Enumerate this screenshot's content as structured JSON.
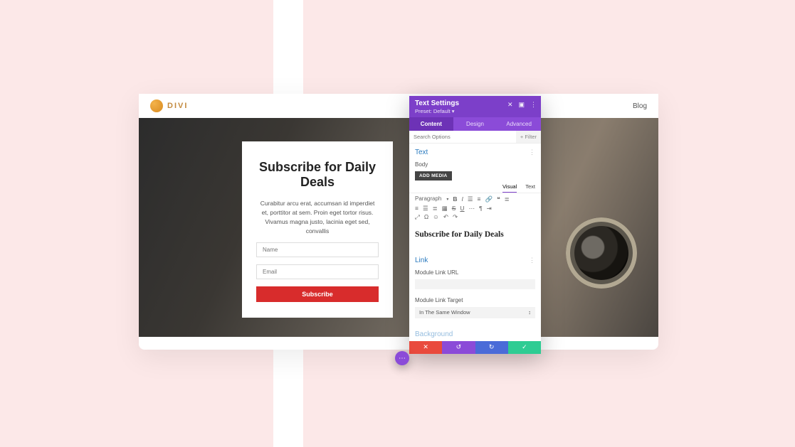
{
  "logo": "DIVI",
  "nav": {
    "blog": "Blog"
  },
  "optin": {
    "title": "Subscribe for Daily Deals",
    "body": "Curabitur arcu erat, accumsan id imperdiet et, porttitor at sem. Proin eget tortor risus. Vivamus magna justo, lacinia eget sed, convallis",
    "name_placeholder": "Name",
    "email_placeholder": "Email",
    "button": "Subscribe"
  },
  "panel": {
    "title": "Text Settings",
    "preset": "Preset: Default ▾",
    "tabs": {
      "content": "Content",
      "design": "Design",
      "advanced": "Advanced"
    },
    "search_placeholder": "Search Options",
    "filter": "Filter",
    "sections": {
      "text": "Text",
      "link": "Link",
      "background": "Background"
    },
    "body_label": "Body",
    "add_media": "ADD MEDIA",
    "editor_tabs": {
      "visual": "Visual",
      "text": "Text"
    },
    "paragraph": "Paragraph",
    "editor_content": "Subscribe for Daily Deals",
    "link_url_label": "Module Link URL",
    "link_target_label": "Module Link Target",
    "link_target_value": "In The Same Window"
  }
}
